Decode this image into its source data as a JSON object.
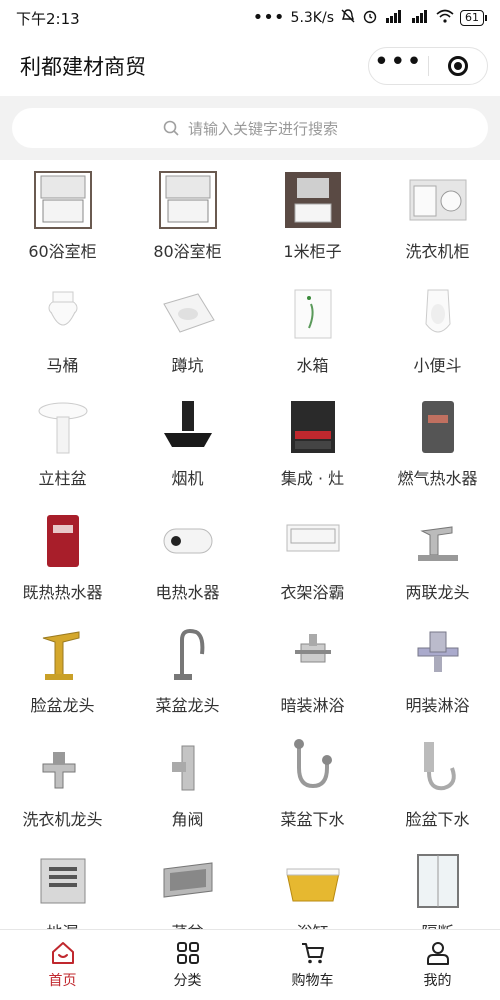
{
  "status_bar": {
    "time": "下午2:13",
    "network_speed": "5.3K/s",
    "battery": "61",
    "icons": [
      "mute-icon",
      "alarm-icon",
      "hd-signal-icon",
      "signal-icon",
      "wifi-icon",
      "battery-icon"
    ]
  },
  "header": {
    "title": "利都建材商贸",
    "menu_icon": "more-dots-icon",
    "close_icon": "target-icon"
  },
  "search": {
    "placeholder": "请输入关键字进行搜索"
  },
  "categories": [
    {
      "label": "60浴室柜",
      "icon": "bathroom-cabinet-icon"
    },
    {
      "label": "80浴室柜",
      "icon": "bathroom-cabinet-icon"
    },
    {
      "label": "1米柜子",
      "icon": "cabinet-icon"
    },
    {
      "label": "洗衣机柜",
      "icon": "laundry-cabinet-icon"
    },
    {
      "label": "马桶",
      "icon": "toilet-icon"
    },
    {
      "label": "蹲坑",
      "icon": "squat-toilet-icon"
    },
    {
      "label": "水箱",
      "icon": "water-tank-icon"
    },
    {
      "label": "小便斗",
      "icon": "urinal-icon"
    },
    {
      "label": "立柱盆",
      "icon": "pedestal-basin-icon"
    },
    {
      "label": "烟机",
      "icon": "range-hood-icon"
    },
    {
      "label": "集成 · 灶",
      "icon": "integrated-stove-icon"
    },
    {
      "label": "燃气热水器",
      "icon": "gas-water-heater-icon"
    },
    {
      "label": "既热热水器",
      "icon": "instant-water-heater-icon"
    },
    {
      "label": "电热水器",
      "icon": "electric-water-heater-icon"
    },
    {
      "label": "衣架浴霸",
      "icon": "bath-heater-icon"
    },
    {
      "label": "两联龙头",
      "icon": "faucet-icon"
    },
    {
      "label": "脸盆龙头",
      "icon": "basin-faucet-icon"
    },
    {
      "label": "菜盆龙头",
      "icon": "kitchen-faucet-icon"
    },
    {
      "label": "暗装淋浴",
      "icon": "concealed-shower-icon"
    },
    {
      "label": "明装淋浴",
      "icon": "exposed-shower-icon"
    },
    {
      "label": "洗衣机龙头",
      "icon": "washer-tap-icon"
    },
    {
      "label": "角阀",
      "icon": "angle-valve-icon"
    },
    {
      "label": "菜盆下水",
      "icon": "sink-drain-icon"
    },
    {
      "label": "脸盆下水",
      "icon": "basin-drain-icon"
    },
    {
      "label": "地漏",
      "icon": "floor-drain-icon"
    },
    {
      "label": "菜盆",
      "icon": "sink-icon"
    },
    {
      "label": "浴缸",
      "icon": "bathtub-icon"
    },
    {
      "label": "隔断",
      "icon": "shower-partition-icon"
    }
  ],
  "tabbar": {
    "items": [
      {
        "label": "首页",
        "icon": "home-icon",
        "active": true
      },
      {
        "label": "分类",
        "icon": "category-icon",
        "active": false
      },
      {
        "label": "购物车",
        "icon": "cart-icon",
        "active": false
      },
      {
        "label": "我的",
        "icon": "user-icon",
        "active": false
      }
    ]
  },
  "colors": {
    "accent": "#c0282e",
    "search_bg": "#f2f2f2"
  }
}
